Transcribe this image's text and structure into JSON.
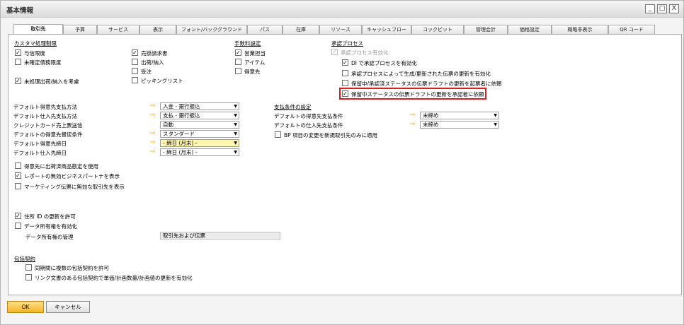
{
  "window": {
    "title": "基本情報",
    "controls": [
      "_",
      "□",
      "X"
    ]
  },
  "tabs": [
    "取引先",
    "予算",
    "サービス",
    "表示",
    "フォント/バックグラウンド",
    "パス",
    "在庫",
    "リソース",
    "キャッシュフロー",
    "コックピット",
    "管理会計",
    "価格設定",
    "概略非表示",
    "QR コード"
  ],
  "customer_section": {
    "title": "カスタマ処理制限",
    "credit_limit": "与信限度",
    "commitment_limit": "未確定債務限度",
    "consider_unprocessed": "未処理出荷/納入を考慮"
  },
  "docs": {
    "sales_invoice": "売掛請求書",
    "delivery": "出荷/納入",
    "order": "受注",
    "picking_list": "ピッキングリスト"
  },
  "commission": {
    "title": "手数料設定",
    "sales_employee": "営業担当",
    "item": "アイテム",
    "customer": "得意先"
  },
  "approval": {
    "title": "承認プロセス",
    "enable": "承認プロセス有効化",
    "di_enable": "DI で承認プロセスを有効化",
    "enable_update": "承認プロセスによって生成/更新された伝票の更新を有効化",
    "request_originator": "保留中/承認済ステータスの伝票ドラフトの更新を起票者に依頼",
    "request_approver": "保留中ステータスの伝票ドラフトの更新を承認者に依頼"
  },
  "defaults": {
    "cust_payment_method": {
      "label": "デフォルト得意先支払方法",
      "value": "入金 - 銀行振込"
    },
    "vend_payment_method": {
      "label": "デフォルト仕入先支払方法",
      "value": "支払 - 銀行振込"
    },
    "credit_card": {
      "label": "クレジットカード売上票送信",
      "value": "自動"
    },
    "dunning_term": {
      "label": "デフォルトの得意先督促条件",
      "value": "スタンダード"
    },
    "cust_closing_date": {
      "label": "デフォルト得意先締日",
      "value": "- 締日 (月末) -"
    },
    "vend_closing_date": {
      "label": "デフォルト仕入先締日",
      "value": "- 締日 (月末) -"
    }
  },
  "payment_terms": {
    "title": "支払条件の設定",
    "cust_term": {
      "label": "デフォルトの得意先支払条件",
      "value": "末締め"
    },
    "vend_term": {
      "label": "デフォルトの仕入先支払条件",
      "value": "末締め"
    },
    "bp_new_only": "BP 項目の変更を新規取引先のみに適用"
  },
  "misc": {
    "use_delivered_goods": "得意先に出荷済商品勘定を使用",
    "show_inactive_partners": "レポートの無効ビジネスパートナを表示",
    "marketing_inactive": "マーケティング伝票に無効な取引先を表示",
    "allow_address_id": "住所 ID の更新を許可",
    "data_ownership": "データ所有権を有効化",
    "ownership_mgmt_label": "データ所有権の管理",
    "ownership_mgmt_value": "取引先および伝票"
  },
  "blanket": {
    "title": "包括契約",
    "allow_multiple": "同期間に複数の包括契約を許可",
    "enable_update": "リンク文書のある包括契約で単価/計画数量/計画値の更新を有効化"
  },
  "buttons": {
    "ok": "OK",
    "cancel": "キャンセル"
  }
}
